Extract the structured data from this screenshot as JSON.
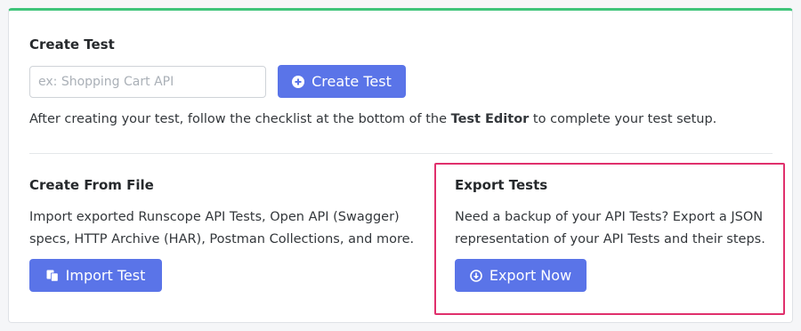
{
  "create_test": {
    "title": "Create Test",
    "input_placeholder": "ex: Shopping Cart API",
    "input_value": "",
    "button_label": "Create Test",
    "helper_before": "After creating your test, follow the checklist at the bottom of the ",
    "helper_bold": "Test Editor",
    "helper_after": " to complete your test setup."
  },
  "create_from_file": {
    "title": "Create From File",
    "description_line1": "Import exported Runscope API Tests, Open API (Swagger)",
    "description_line2": "specs, HTTP Archive (HAR), Postman Collections, and more.",
    "button_label": "Import Test"
  },
  "export_tests": {
    "title": "Export Tests",
    "description_line1": "Need a backup of your API Tests? Export a JSON",
    "description_line2": "representation of your API Tests and their steps.",
    "button_label": "Export Now"
  },
  "colors": {
    "accent_button": "#5a74e8",
    "top_border": "#3fc47a",
    "highlight_border": "#e0306c"
  },
  "icons": {
    "create_button": "plus-circle-icon",
    "import_button": "file-copy-icon",
    "export_button": "download-circle-icon"
  }
}
